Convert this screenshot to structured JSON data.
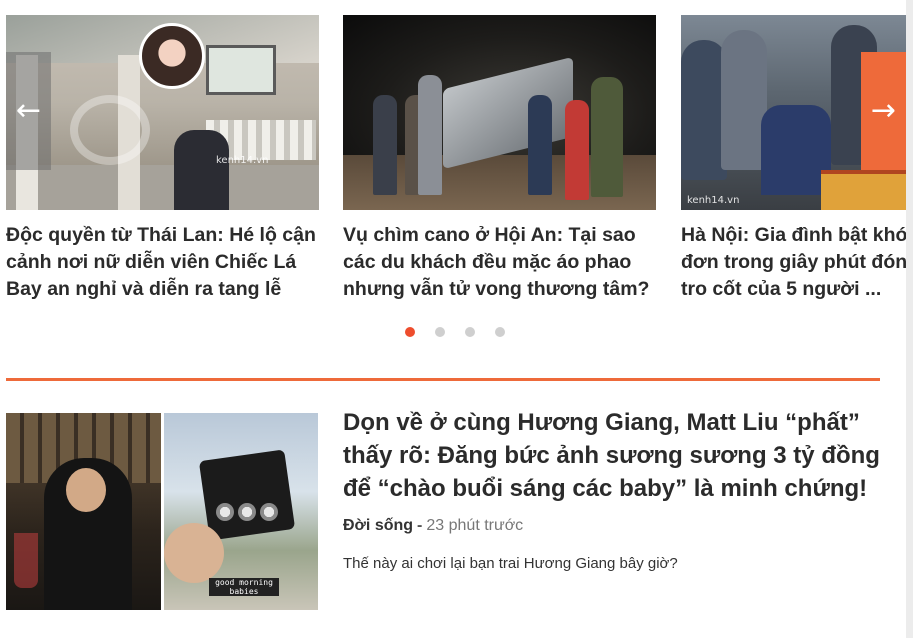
{
  "slider": {
    "cards": [
      {
        "title_lines": [
          "Độc quyền từ Thái Lan: Hé lộ cận",
          "cảnh nơi nữ diễn viên Chiếc Lá",
          "Bay an nghỉ và diễn ra tang lễ"
        ],
        "watermark": "kenh14.vn"
      },
      {
        "title_lines": [
          "Vụ chìm cano ở Hội An: Tại sao",
          "các du khách đều mặc áo phao",
          "nhưng vẫn tử vong thương tâm?"
        ]
      },
      {
        "title_lines": [
          "Hà Nội: Gia đình bật khó",
          "đơn trong giây phút đón",
          "tro cốt của 5 người ..."
        ],
        "watermark": "kenh14.vn"
      }
    ],
    "prev_arrow": "←",
    "next_arrow": "→",
    "dots_count": 4,
    "active_dot": 1,
    "accent_color": "#ee4d2d"
  },
  "article": {
    "title": "Dọn về ở cùng Hương Giang, Matt Liu “phất” thấy rõ: Đăng bức ảnh sương sương 3 tỷ đồng để “chào buổi sáng các baby” là minh chứng!",
    "category": "Đời sống",
    "separator": "-",
    "time": "23 phút trước",
    "sapo": "Thế này ai chơi lại bạn trai Hương Giang bây giờ?",
    "image_caption": "good morning babies"
  }
}
